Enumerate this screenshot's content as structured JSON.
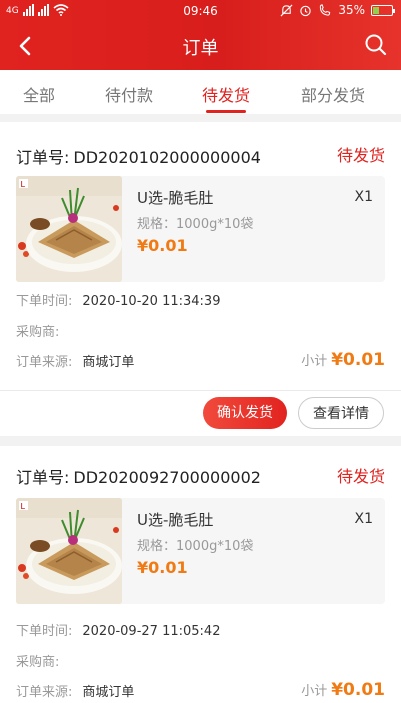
{
  "status_bar": {
    "network_label": "4G",
    "time": "09:46",
    "battery": "35%"
  },
  "header": {
    "title": "订单"
  },
  "tabs": [
    {
      "label": "全部",
      "active": false
    },
    {
      "label": "待付款",
      "active": false
    },
    {
      "label": "待发货",
      "active": true
    },
    {
      "label": "部分发货",
      "active": false
    }
  ],
  "orders": [
    {
      "order_no_label": "订单号:",
      "order_no": "DD2020102000000004",
      "status": "待发货",
      "item": {
        "name": "U选-脆毛肚",
        "qty": "X1",
        "spec": "规格：1000g*10袋",
        "price": "¥0.01"
      },
      "time_label": "下单时间:",
      "time": "2020-10-20 11:34:39",
      "buyer_label": "采购商:",
      "source_label": "订单来源:",
      "source": "商城订单",
      "subtotal_label": "小计",
      "subtotal": "¥0.01",
      "confirm_label": "确认发货",
      "detail_label": "查看详情"
    },
    {
      "order_no_label": "订单号:",
      "order_no": "DD2020092700000002",
      "status": "待发货",
      "item": {
        "name": "U选-脆毛肚",
        "qty": "X1",
        "spec": "规格：1000g*10袋",
        "price": "¥0.01"
      },
      "time_label": "下单时间:",
      "time": "2020-09-27 11:05:42",
      "buyer_label": "采购商:",
      "source_label": "订单来源:",
      "source": "商城订单",
      "subtotal_label": "小计",
      "subtotal": "¥0.01"
    }
  ],
  "colors": {
    "brand": "#e0231f",
    "price": "#f07a13"
  }
}
